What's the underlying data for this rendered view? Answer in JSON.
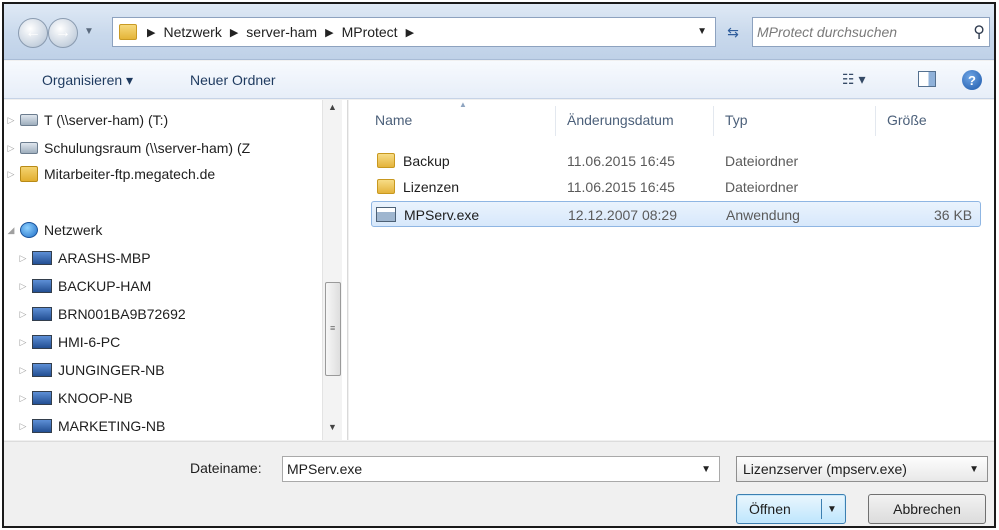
{
  "address": {
    "breadcrumbs": [
      "Netzwerk",
      "server-ham",
      "MProtect"
    ],
    "search_placeholder": "MProtect durchsuchen"
  },
  "toolbar": {
    "organize_label": "Organisieren ▾",
    "new_folder_label": "Neuer Ordner"
  },
  "nav_pane": {
    "items": [
      {
        "label": "T (\\\\server-ham) (T:)",
        "icon": "network-drive-icon"
      },
      {
        "label": "Schulungsraum (\\\\server-ham) (Z",
        "icon": "network-drive-icon"
      },
      {
        "label": "Mitarbeiter-ftp.megatech.de",
        "icon": "ftp-location-icon"
      },
      {
        "label": "Netzwerk",
        "icon": "network-icon"
      },
      {
        "label": "ARASHS-MBP",
        "icon": "computer-icon"
      },
      {
        "label": "BACKUP-HAM",
        "icon": "computer-icon"
      },
      {
        "label": "BRN001BA9B72692",
        "icon": "computer-icon"
      },
      {
        "label": "HMI-6-PC",
        "icon": "computer-icon"
      },
      {
        "label": "JUNGINGER-NB",
        "icon": "computer-icon"
      },
      {
        "label": "KNOOP-NB",
        "icon": "computer-icon"
      },
      {
        "label": "MARKETING-NB",
        "icon": "computer-icon"
      }
    ]
  },
  "file_list": {
    "columns": [
      "Name",
      "Änderungsdatum",
      "Typ",
      "Größe"
    ],
    "rows": [
      {
        "name": "Backup",
        "date": "11.06.2015 16:45",
        "type": "Dateiordner",
        "size": "",
        "icon": "folder-icon"
      },
      {
        "name": "Lizenzen",
        "date": "11.06.2015 16:45",
        "type": "Dateiordner",
        "size": "",
        "icon": "folder-icon"
      },
      {
        "name": "MPServ.exe",
        "date": "12.12.2007 08:29",
        "type": "Anwendung",
        "size": "36 KB",
        "icon": "application-icon"
      }
    ]
  },
  "bottom": {
    "filename_label": "Dateiname:",
    "filename_value": "MPServ.exe",
    "filter_value": "Lizenzserver (mpserv.exe)",
    "open_label": "Öffnen",
    "cancel_label": "Abbrechen"
  }
}
